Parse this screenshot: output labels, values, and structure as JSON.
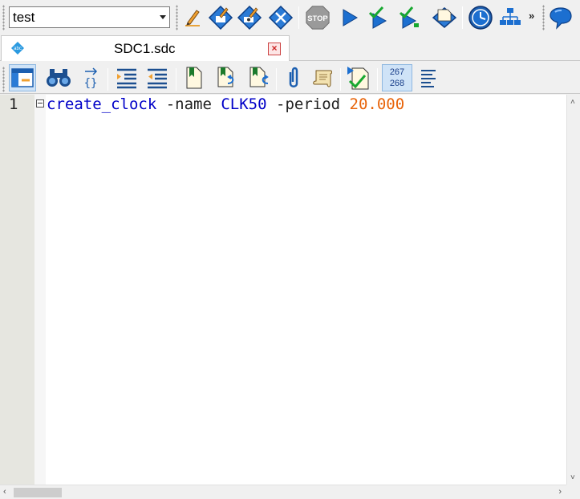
{
  "toolbar": {
    "project_combo_value": "test",
    "overflow_label": "»",
    "buttons": [
      {
        "icon": "pencil-icon"
      },
      {
        "icon": "compile-diamond-icon"
      },
      {
        "icon": "compile-run-diamond-icon"
      },
      {
        "icon": "cross-diamond-icon"
      },
      {
        "icon": "stop-icon",
        "label": "STOP"
      },
      {
        "icon": "play-icon"
      },
      {
        "icon": "check-play-icon"
      },
      {
        "icon": "check-play-green-icon"
      },
      {
        "icon": "download-diamond-icon"
      },
      {
        "icon": "clock-icon"
      },
      {
        "icon": "hierarchy-icon"
      },
      {
        "icon": "chat-bubble-icon"
      }
    ]
  },
  "tab": {
    "title": "SDC1.sdc",
    "close_label": "×"
  },
  "editor_toolbar": {
    "line_numbers_top": "267",
    "line_numbers_bottom": "268"
  },
  "editor": {
    "lines": [
      {
        "number": "1",
        "tokens": {
          "command": "create_clock",
          "opt1": " -name ",
          "name_value": "CLK50",
          "opt2": " -period ",
          "period_value": "20.000"
        }
      }
    ]
  },
  "colors": {
    "keyword": "#0000c8",
    "number": "#e8640a",
    "accent": "#1c6fd0"
  }
}
